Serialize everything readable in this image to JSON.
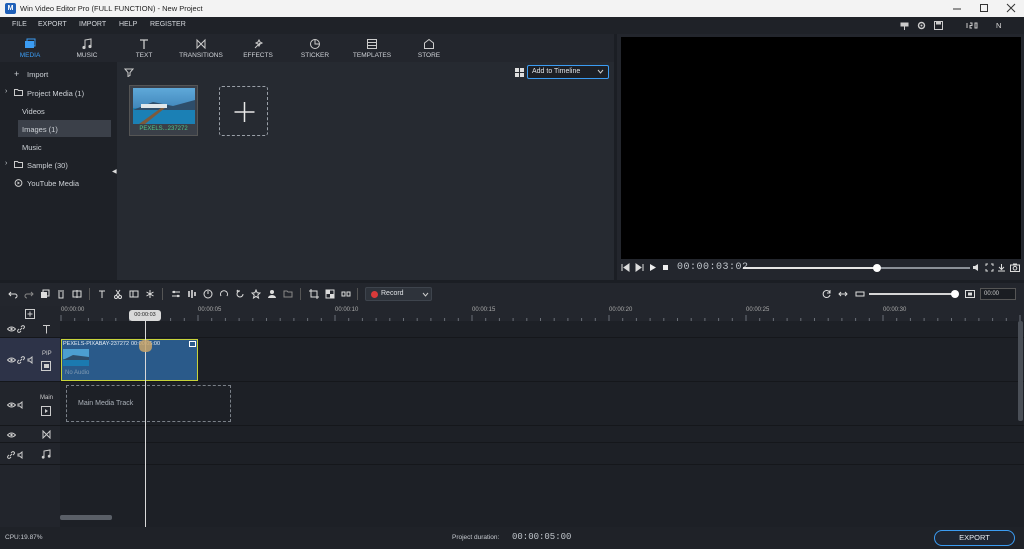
{
  "titlebar": {
    "title": "Win Video Editor Pro (FULL FUNCTION) - New Project",
    "logo": "M"
  },
  "menu": [
    "FILE",
    "EXPORT",
    "IMPORT",
    "HELP",
    "REGISTER"
  ],
  "menu_right": {
    "user_initial": "N"
  },
  "tabs": [
    {
      "label": "MEDIA",
      "icon": "media-icon"
    },
    {
      "label": "MUSIC",
      "icon": "music-icon"
    },
    {
      "label": "TEXT",
      "icon": "text-icon"
    },
    {
      "label": "TRANSITIONS",
      "icon": "transitions-icon"
    },
    {
      "label": "EFFECTS",
      "icon": "effects-icon"
    },
    {
      "label": "STICKER",
      "icon": "sticker-icon"
    },
    {
      "label": "TEMPLATES",
      "icon": "templates-icon"
    },
    {
      "label": "STORE",
      "icon": "store-icon"
    }
  ],
  "sidebar": {
    "import": "Import",
    "project_media": "Project Media (1)",
    "videos": "Videos",
    "images": "Images (1)",
    "music": "Music",
    "sample": "Sample (30)",
    "youtube": "YouTube Media"
  },
  "media": {
    "add_to_timeline": "Add to Timeline",
    "thumb_label": "PEXELS...237272"
  },
  "preview": {
    "timecode": "00:00:03:02",
    "progress": 0.59
  },
  "toolbar": {
    "record": "Record"
  },
  "ruler": [
    "00:00:00",
    "00:00:05",
    "00:00:10",
    "00:00:15",
    "00:00:20",
    "00:00:25",
    "00:00:30"
  ],
  "playhead": {
    "label": "00:00:03"
  },
  "tracks": {
    "pip_label": "PIP",
    "main_label": "Main",
    "clip_name": "PEXELS-PIXABAY-237272",
    "clip_time": "00:00:05:00",
    "clip_audio": "No Audio",
    "main_placeholder": "Main Media Track"
  },
  "zoom": {
    "value": "00:00"
  },
  "status": {
    "cpu": "CPU:19.87%",
    "duration_label": "Project duration:",
    "duration": "00:00:05:00",
    "export": "EXPORT"
  },
  "colors": {
    "accent": "#3b9cf3",
    "clip_border": "#c8d43a",
    "record": "#d83a3a",
    "playhead": "#d9d9d9"
  }
}
